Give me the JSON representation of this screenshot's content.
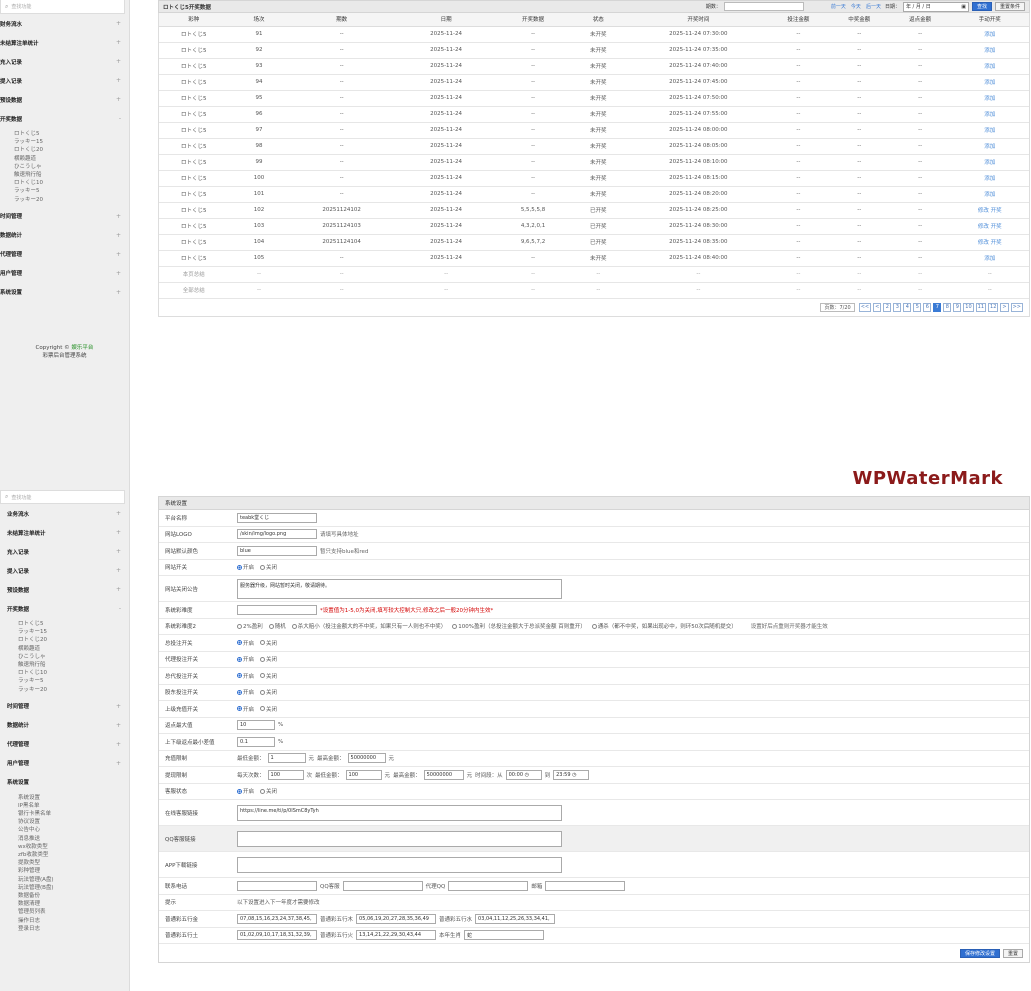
{
  "top": {
    "search_placeholder": "查找功能",
    "menu": [
      {
        "label": "财务流水"
      },
      {
        "label": "未结算注单统计"
      },
      {
        "label": "充入记录"
      },
      {
        "label": "提入记录"
      },
      {
        "label": "预设数据"
      }
    ],
    "open_menu": "开奖数据",
    "submenu": [
      "ロトくじ5",
      "ラッキー15",
      "ロトくじ20",
      "横赖趣道",
      "ひこうしゃ",
      "触速飛行船",
      "ロトくじ10",
      "ラッキー5",
      "ラッキー20"
    ],
    "menu_after": [
      {
        "label": "时间管理"
      },
      {
        "label": "数据统计"
      },
      {
        "label": "代理管理"
      },
      {
        "label": "用户管理"
      },
      {
        "label": "系统设置"
      }
    ],
    "copyright_label": "Copyright ©",
    "copyright_link": "娱乐平台",
    "copyright_sub": "彩票后台管理系统"
  },
  "table": {
    "title": "ロトくじ5开奖数据",
    "issue_label": "期数：",
    "quick_links": [
      "前一天",
      "今天",
      "后一天"
    ],
    "date_label": "日期：",
    "date_placeholder": "年 / 月 / 日",
    "search_button": "查找",
    "reset_button": "重置条件",
    "columns": [
      "彩种",
      "场次",
      "期数",
      "日期",
      "开奖数据",
      "状态",
      "开奖时间",
      "投注金额",
      "中奖金额",
      "返点金额",
      "手动开奖"
    ],
    "rows": [
      [
        "ロトくじ5",
        "91",
        "--",
        "2025-11-24",
        "--",
        "未开奖",
        "2025-11-24 07:30:00",
        "--",
        "--",
        "--",
        "添加"
      ],
      [
        "ロトくじ5",
        "92",
        "--",
        "2025-11-24",
        "--",
        "未开奖",
        "2025-11-24 07:35:00",
        "--",
        "--",
        "--",
        "添加"
      ],
      [
        "ロトくじ5",
        "93",
        "--",
        "2025-11-24",
        "--",
        "未开奖",
        "2025-11-24 07:40:00",
        "--",
        "--",
        "--",
        "添加"
      ],
      [
        "ロトくじ5",
        "94",
        "--",
        "2025-11-24",
        "--",
        "未开奖",
        "2025-11-24 07:45:00",
        "--",
        "--",
        "--",
        "添加"
      ],
      [
        "ロトくじ5",
        "95",
        "--",
        "2025-11-24",
        "--",
        "未开奖",
        "2025-11-24 07:50:00",
        "--",
        "--",
        "--",
        "添加"
      ],
      [
        "ロトくじ5",
        "96",
        "--",
        "2025-11-24",
        "--",
        "未开奖",
        "2025-11-24 07:55:00",
        "--",
        "--",
        "--",
        "添加"
      ],
      [
        "ロトくじ5",
        "97",
        "--",
        "2025-11-24",
        "--",
        "未开奖",
        "2025-11-24 08:00:00",
        "--",
        "--",
        "--",
        "添加"
      ],
      [
        "ロトくじ5",
        "98",
        "--",
        "2025-11-24",
        "--",
        "未开奖",
        "2025-11-24 08:05:00",
        "--",
        "--",
        "--",
        "添加"
      ],
      [
        "ロトくじ5",
        "99",
        "--",
        "2025-11-24",
        "--",
        "未开奖",
        "2025-11-24 08:10:00",
        "--",
        "--",
        "--",
        "添加"
      ],
      [
        "ロトくじ5",
        "100",
        "--",
        "2025-11-24",
        "--",
        "未开奖",
        "2025-11-24 08:15:00",
        "--",
        "--",
        "--",
        "添加"
      ],
      [
        "ロトくじ5",
        "101",
        "--",
        "2025-11-24",
        "--",
        "未开奖",
        "2025-11-24 08:20:00",
        "--",
        "--",
        "--",
        "添加"
      ],
      [
        "ロトくじ5",
        "102",
        "20251124102",
        "2025-11-24",
        "5,5,5,5,8",
        "已开奖",
        "2025-11-24 08:25:00",
        "--",
        "--",
        "--",
        "修改 开奖"
      ],
      [
        "ロトくじ5",
        "103",
        "20251124103",
        "2025-11-24",
        "4,3,2,0,1",
        "已开奖",
        "2025-11-24 08:30:00",
        "--",
        "--",
        "--",
        "修改 开奖"
      ],
      [
        "ロトくじ5",
        "104",
        "20251124104",
        "2025-11-24",
        "9,6,5,7,2",
        "已开奖",
        "2025-11-24 08:35:00",
        "--",
        "--",
        "--",
        "修改 开奖"
      ],
      [
        "ロトくじ5",
        "105",
        "--",
        "2025-11-24",
        "--",
        "未开奖",
        "2025-11-24 08:40:00",
        "--",
        "--",
        "--",
        "添加"
      ]
    ],
    "summary_rows": [
      [
        "本页总结",
        "--",
        "--",
        "--",
        "--",
        "--",
        "--",
        "--",
        "--",
        "--",
        "--"
      ],
      [
        "全部总结",
        "--",
        "--",
        "--",
        "--",
        "--",
        "--",
        "--",
        "--",
        "--",
        "--"
      ]
    ],
    "pager_info": "页数：7/20",
    "pages": [
      "<<",
      "<",
      "2",
      "3",
      "4",
      "5",
      "6",
      "7",
      "8",
      "9",
      "10",
      "11",
      "12",
      ">",
      ">>"
    ],
    "current_page": "7"
  },
  "watermark": "WPWaterMark",
  "bottom": {
    "search_placeholder": "查找功能",
    "menu": [
      {
        "label": "业务流水"
      },
      {
        "label": "未结算注单统计"
      },
      {
        "label": "充入记录"
      },
      {
        "label": "提入记录"
      },
      {
        "label": "预设数据"
      }
    ],
    "open_menu": "开奖数据",
    "submenu": [
      "ロトくじ5",
      "ラッキー15",
      "ロトくじ20",
      "横赖趣道",
      "ひこうしゃ",
      "触速飛行船",
      "ロトくじ10",
      "ラッキー5",
      "ラッキー20"
    ],
    "menu_after": [
      {
        "label": "时间管理"
      },
      {
        "label": "数据统计"
      },
      {
        "label": "代理管理"
      },
      {
        "label": "用户管理"
      }
    ],
    "open_menu2": "系统设置",
    "submenu2": [
      "系统设置",
      "IP黑名单",
      "银行卡黑名单",
      "协议设置",
      "公告中心",
      "消息推送",
      "wx收款类型",
      "zfb收款类型",
      "提款类型",
      "彩种管理",
      "玩法管理(A盘)",
      "玩法管理(B盘)",
      "数据备份",
      "数据清理",
      "管理员列表",
      "操作日志",
      "登录日志"
    ]
  },
  "settings": {
    "title": "系统设置",
    "site_name_label": "平台名称",
    "site_name": "teabk堂くじ",
    "logo_label": "网站LOGO",
    "logo_value": "/skin/img/logo.png",
    "logo_hint": "请填写具体地址",
    "color_label": "网站默认颜色",
    "color_value": "blue",
    "color_hint": "暂只支持blue和red",
    "switch_label": "网站开关",
    "on": "开启",
    "off": "关闭",
    "notice_label": "网站关闭公告",
    "notice_value": "服务器升级，网站暂时关闭，敬请期待。",
    "difficulty_label": "系统彩难度",
    "difficulty_hint": "*设置值为1-5,0为关闭,填写较大控制大只,修改之后一般20分钟内生效*",
    "difficulty2_label": "系统彩难度2",
    "difficulty2_opts": [
      "2%盈利",
      "随机",
      "杀大赔小（投注金额大的不中奖，如果只有一人则也不中奖）",
      "100%盈利（总投注金额大于总派奖金额 百则重开）",
      "通杀（都不中奖，如果出现必中，则环50次后随机提交）"
    ],
    "difficulty2_note": "设置好后点重则开奖器才能生效",
    "switches": [
      {
        "label": "总投注开关"
      },
      {
        "label": "代理投注开关"
      },
      {
        "label": "总代投注开关"
      },
      {
        "label": "股东投注开关"
      },
      {
        "label": "上级充值开关"
      }
    ],
    "rebate_max_label": "返点最大值",
    "rebate_max": "10",
    "rebate_diff_label": "上下级返点最小差值",
    "rebate_diff": "0.1",
    "pct": "%",
    "recharge_label": "充值限制",
    "min_amount": "最低金额：",
    "recharge_min": "1",
    "yuan": "元",
    "max_amount": "最高金额：",
    "recharge_max": "50000000",
    "withdraw_label": "提现限制",
    "withdraw_times": "每天次数：",
    "withdraw_times_val": "100",
    "times_unit": "次",
    "withdraw_min": "100",
    "withdraw_max": "50000000",
    "time_range": "时间段：从",
    "time_from": "00:00",
    "to": "到",
    "time_to": "23:59",
    "service_switch_label": "客服状态",
    "service_link_label": "在线客服链接",
    "service_link": "https://line.me/ti/p/0ISmC8yTyh",
    "qq_link_label": "QQ客服链接",
    "app_link_label": "APP下载链接",
    "contact_label": "联系电话",
    "qq_service": "QQ客服",
    "agent_qq": "代理QQ",
    "email": "邮箱",
    "tip_label": "提示",
    "tip_value": "以下设置进入下一年度才需要修改",
    "zodiac1_label": "普通彩五行金",
    "zodiac1": "07,08,15,16,23,24,37,38,45,",
    "zodiac2_label": "普通彩五行木",
    "zodiac2": "05,06,19,20,27,28,35,36,49",
    "zodiac3_label": "普通彩五行水",
    "zodiac3": "03,04,11,12,25,26,33,34,41,",
    "zodiac4_label": "普通彩五行土",
    "zodiac4": "01,02,09,10,17,18,31,32,39,",
    "zodiac5_label": "普通彩五行火",
    "zodiac5": "13,14,21,22,29,30,43,44",
    "year_label": "本年生肖",
    "year_value": "蛇",
    "save_button": "保存修改设置",
    "reset_button": "重置"
  }
}
